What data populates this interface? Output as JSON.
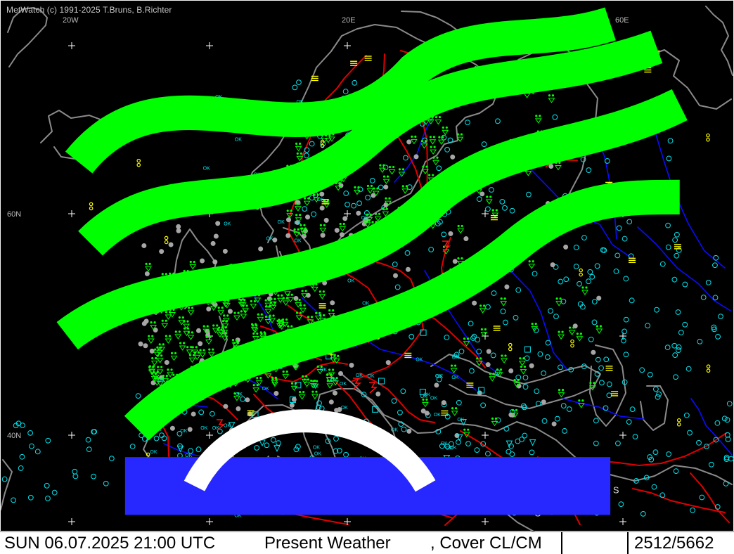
{
  "app": {
    "credit": "MetWatch  (c) 1991-2025 T.Bruns, B.Richter"
  },
  "map": {
    "grid_labels": {
      "lon_20w": "20W",
      "lon_20e": "20E",
      "lon_60e": "60E",
      "lat_60n": "60N",
      "lat_40n": "40N"
    },
    "symbol_text": {
      "ok": "OK",
      "sand": "S"
    }
  },
  "status_bar": {
    "date_time": "SUN 06.07.2025 21:00 UTC",
    "product": "Present Weather",
    "cover": ", Cover CL/CM",
    "station_count": "2512/5662"
  },
  "colors": {
    "background": "#000000",
    "frame": "#f2f2f2",
    "coast": "#8a8a8a",
    "borders": "#e00000",
    "rivers": "#0b0bff",
    "cyan": "#00e5ee",
    "green": "#00ff00",
    "yellow": "#ffff00",
    "gray": "#a6a6a6",
    "white": "#ffffff",
    "status_bar": "#ffffff"
  },
  "icons": {
    "logo": "metwatch-logo-icon",
    "grid_mark": "plus-icon"
  }
}
